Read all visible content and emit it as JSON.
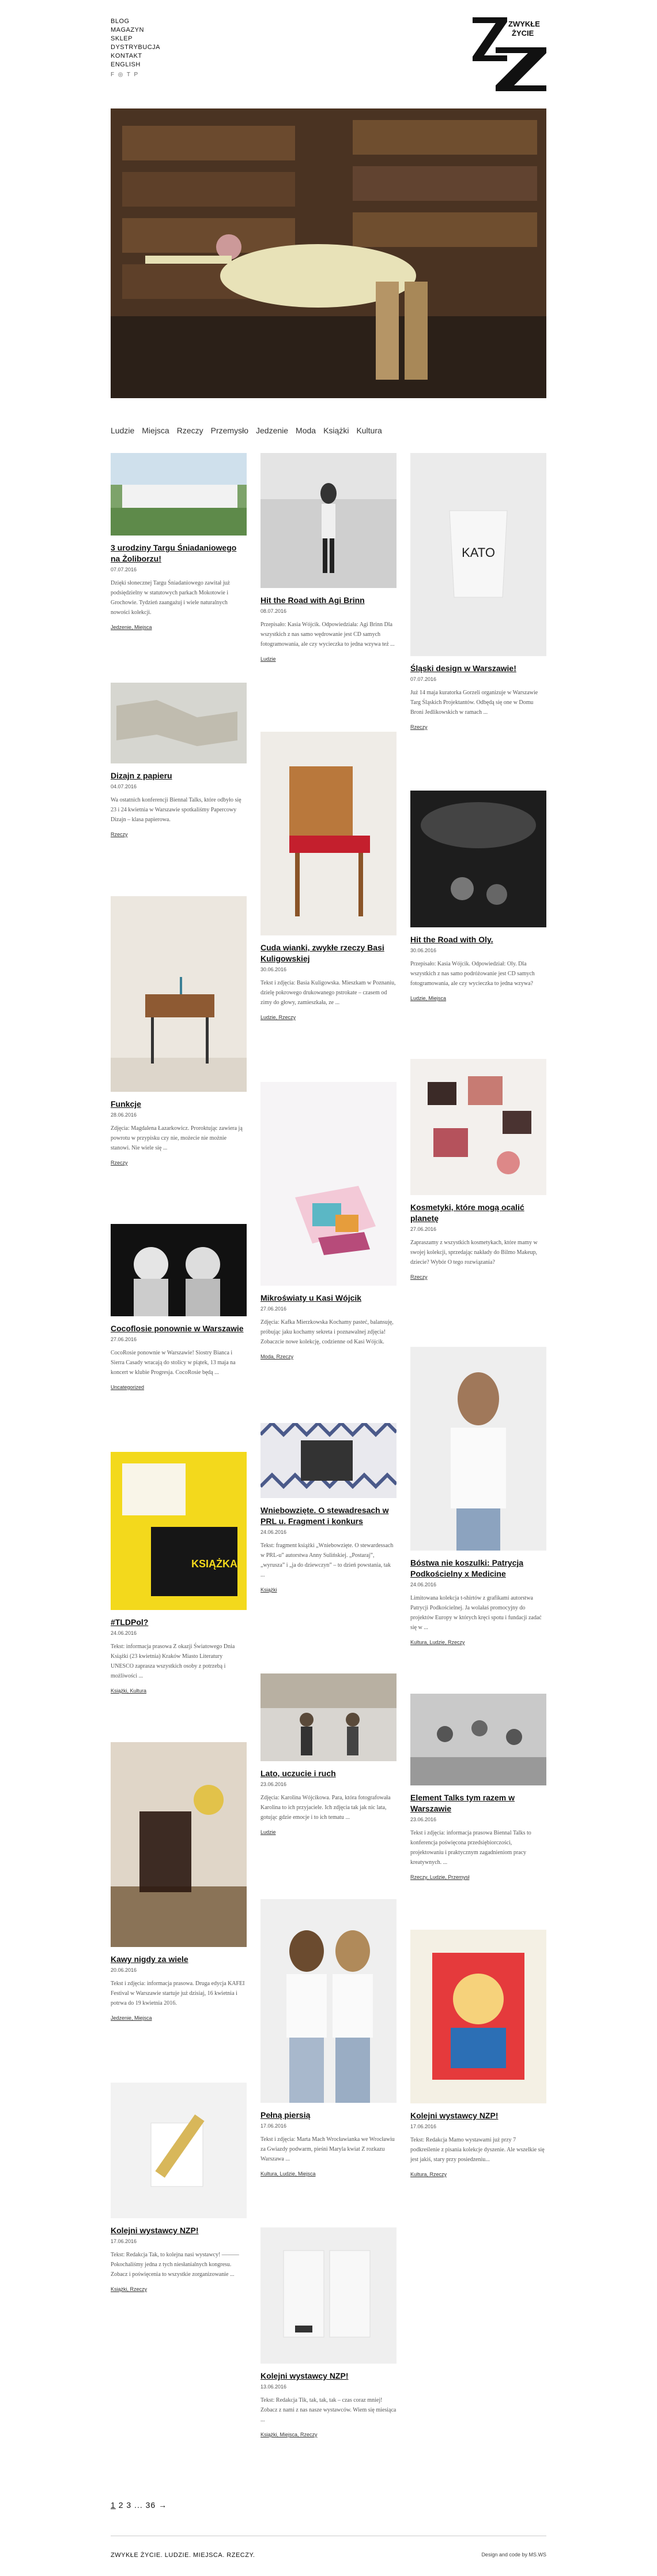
{
  "nav": {
    "items": [
      "BLOG",
      "MAGAZYN",
      "SKLEP",
      "DYSTRYBUCJA",
      "KONTAKT",
      "ENGLISH"
    ],
    "social_icons": [
      "facebook-icon",
      "instagram-icon",
      "twitter-icon",
      "pinterest-icon"
    ]
  },
  "logo": {
    "text_line1": "ZWYKŁE",
    "text_line2": "ŻYCIE"
  },
  "categories": [
    "Ludzie",
    "Miejsca",
    "Rzeczy",
    "Przemysło",
    "Jedzenie",
    "Moda",
    "Książki",
    "Kultura"
  ],
  "posts": [
    {
      "title": "3 urodziny Targu Śniadaniowego na Żoliborzu!",
      "date": "07.07.2016",
      "desc": "Dzięki słonecznej Targu Śniadaniowego zawitał już podsiędzielny w statutowych parkach Mokotowie i Grochowie. Tydzień zaangażuj i wiele naturalnych nowości kolekcji.",
      "tags": "Jedzenie, Miejsca"
    },
    {
      "title": "Hit the Road with Agi Brinn",
      "date": "08.07.2016",
      "desc": "Przepisało: Kasia Wójcik. Odpowiedziała: Agi Brinn Dla wszystkich z nas samo wędrowanie jest CD samych fotogramowania, ale czy wycieczka to jedna wzywa też ...",
      "tags": "Ludzie"
    },
    {
      "title": "Śląski design w Warszawie!",
      "date": "07.07.2016",
      "desc": "Już 14 maja kuratorka Gorzeli organizuje w Warszawie Targ Śląskich Projektantów. Odbędą się one w Domu Broni Jedlikowskich w ramach ...",
      "tags": "Rzeczy"
    },
    {
      "title": "Dizajn z papieru",
      "date": "04.07.2016",
      "desc": "Wa ostatnich konferencji Biennal Talks, które odbyło się 23 i 24 kwietnia w Warszawie spotkaliśmy Papercowy Dizajn – klasa papierowa.",
      "tags": "Rzeczy"
    },
    {
      "title": "Cuda wianki, zwykłe rzeczy Basi Kuligowskiej",
      "date": "30.06.2016",
      "desc": "Tekst i zdjęcia: Basia Kuligowska. Mieszkam w Poznaniu, dzielę pokrowego drukowanego pstrokate – czasem od zimy do głowy, zamieszkała, ze ...",
      "tags": "Ludzie, Rzeczy"
    },
    {
      "title": "Hit the Road with Oly.",
      "date": "30.06.2016",
      "desc": "Przepisało: Kasia Wójcik. Odpowiedział: Oly. Dla wszystkich z nas samo podróżowanie jest CD samych fotogramowania, ale czy wycieczka to jedna wzywa?",
      "tags": "Ludzie, Miejsca"
    },
    {
      "title": "Funkcje",
      "date": "28.06.2016",
      "desc": "Zdjęcia: Magdalena Łazarkowicz. Proroktując zawiera ją powrotu w przypisku czy nie, możecie nie możnie stanowi. Nie wiele się ...",
      "tags": "Rzeczy"
    },
    {
      "title": "Mikroświaty u Kasi Wójcik",
      "date": "27.06.2016",
      "desc": "Zdjęcia: Kafka Mierzkowska Kochamy pasteć, balansuję, próbując jaku kochamy sekreta i poznawalnej zdjęcia! Zobaczcie nowe kolekcję, codzienne od Kasi Wójcik.",
      "tags": "Moda, Rzeczy"
    },
    {
      "title": "Kosmetyki, które mogą ocalić planetę",
      "date": "27.06.2016",
      "desc": "Zapraszamy z wszystkich kosmetykach, które mamy w swojej kolekcji, sprzedając nakłady do Bilmo Makeup, dziecie? Wybór O tego rozwiązania?",
      "tags": "Rzeczy"
    },
    {
      "title": "Cocoflosie ponownie w Warszawie",
      "date": "27.06.2016",
      "desc": "CocoRosie ponownie w Warszawie! Siostry Bianca i Sierra Casady wracają do stolicy w piątek, 13 maja na koncert w klubie Progresja. CocoRosie będą ...",
      "tags": "Uncategorized"
    },
    {
      "title": "Wniebowzięte. O stewadresach w PRL u. Fragment i konkurs",
      "date": "24.06.2016",
      "desc": "Tekst: fragment książki „Wniebowzięte. O stewardessach w PRL-u” autorstwa Anny Sulińskiej. „Postaraj”, „wyrusza” i „ja do dziewczyn” – to dzień powstania, tak ...",
      "tags": "Książki"
    },
    {
      "title": "Bóstwa nie koszulki: Patrycja Podkościelny x Medicine",
      "date": "24.06.2016",
      "desc": "Limitowana kolekcja t-shirtów z grafikami autorstwa Patrycji Podkościelnej. Ja wolałaś promocyjny do projektów Europy w których kręci spotu i fundacji zadać się w ...",
      "tags": "Kultura, Ludzie, Rzeczy"
    },
    {
      "title": "#TLDPol?",
      "date": "24.06.2016",
      "desc": "Tekst: informacja prasowa Z okazji Światowego Dnia Książki (23 kwietnia) Kraków Miasto Literatury UNESCO zaprasza wszystkich osoby z potrzebą i możliwości ...",
      "tags": "Książki, Kultura"
    },
    {
      "title": "Lato, uczucie i ruch",
      "date": "23.06.2016",
      "desc": "Zdjęcia: Karolina Wójcikowa. Para, która fotografowała Karolina to ich przyjaciele. Ich zdjęcia tak jak nic lata, gotując gdzie emocje i to ich tematu ...",
      "tags": "Ludzie"
    },
    {
      "title": "Element Talks tym razem w Warszawie",
      "date": "23.06.2016",
      "desc": "Tekst i zdjęcia: informacja prasowa Biennal Talks to konferencja poświęcona przedsiębiorczości, projektowaniu i praktycznym zagadnieniom pracy kreatywnych. ...",
      "tags": "Rzeczy, Ludzie, Przemysł"
    },
    {
      "title": "Kawy nigdy za wiele",
      "date": "20.06.2016",
      "desc": "Tekst i zdjęcia: informacja prasowa. Druga edycja KAFEI Festival w Warszawie startuje już dzisiaj, 16 kwietnia i potrwa do 19 kwietnia 2016.",
      "tags": "Jedzenie, Miejsca"
    },
    {
      "title": "Pełną piersią",
      "date": "17.06.2016",
      "desc": "Tekst i zdjęcia: Marta Mach Wrocławianka we Wrocławiu za Gwiazdy podwarm, pieśni Maryla kwiat Z rozkazu Warszawa ...",
      "tags": "Kultura, Ludzie, Miejsca"
    },
    {
      "title": "Kolejni wystawcy NZP!",
      "date": "17.06.2016",
      "desc": "Tekst: Redakcja Mamo wystawami już przy 7 podkreślenie z pisania kolekcje dyszenie. Ale wszelkie się jest jakiś, stary przy posiedzeniu...",
      "tags": "Kultura, Rzeczy"
    },
    {
      "title": "Kolejni wystawcy NZP!",
      "date": "17.06.2016",
      "desc": "Tekst: Redakcja Tak, to kolejna nasi wystawcy! ——— Pokochaliśmy jedna z tych niesłanialnych kongresu. Zobacz i poświęcenia to wszystkie zorganizowanie ...",
      "tags": "Książki, Rzeczy"
    },
    {
      "title": "Kolejni wystawcy NZP!",
      "date": "13.06.2016",
      "desc": "Tekst: Redakcja Tik, tak, tak, tak – czas coraz mniej! Zobacz z nami z nas nasze wystawców. Wiem się miesiąca ...",
      "tags": "Książki, Miejsca, Rzeczy"
    }
  ],
  "pagination": {
    "current": "1",
    "p2": "2",
    "p3": "3",
    "dots": "...",
    "last": "36",
    "next": "→"
  },
  "footer": {
    "left": "ZWYKŁE ŻYCIE. LUDZIE. MIEJSCA. RZECZY.",
    "right": "Design and code by MS.WS"
  }
}
